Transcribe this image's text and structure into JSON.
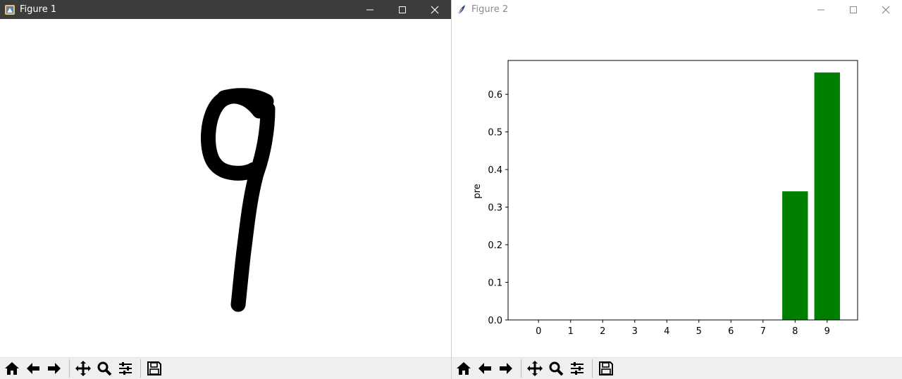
{
  "window1": {
    "title": "Figure 1"
  },
  "window2": {
    "title": "Figure 2"
  },
  "toolbar": {
    "tools": [
      "home-icon",
      "back-arrow-icon",
      "forward-arrow-icon",
      "pan-icon",
      "zoom-icon",
      "configure-subplots-icon",
      "save-icon"
    ]
  },
  "colors": {
    "bar": "#008000",
    "titlebar_active": "#3c3c3c",
    "toolbar_bg": "#efefef"
  },
  "chart_data": {
    "type": "bar",
    "categories": [
      "0",
      "1",
      "2",
      "3",
      "4",
      "5",
      "6",
      "7",
      "8",
      "9"
    ],
    "values": [
      0,
      0,
      0,
      0,
      0,
      0,
      0,
      0,
      0.342,
      0.658
    ],
    "title": "",
    "xlabel": "",
    "ylabel": "pre",
    "ylim": [
      0,
      0.69
    ],
    "yticks": [
      0.0,
      0.1,
      0.2,
      0.3,
      0.4,
      0.5,
      0.6
    ],
    "ytick_labels": [
      "0.0",
      "0.1",
      "0.2",
      "0.3",
      "0.4",
      "0.5",
      "0.6"
    ],
    "grid": false
  }
}
